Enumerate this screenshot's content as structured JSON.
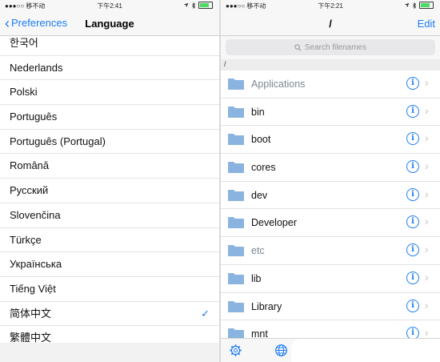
{
  "left": {
    "status": {
      "carrier": "●●●○○ 移不动",
      "time": "下午2:41"
    },
    "nav": {
      "back_label": "Preferences",
      "title": "Language"
    },
    "languages": [
      {
        "label": "한국어",
        "selected": false
      },
      {
        "label": "Nederlands",
        "selected": false
      },
      {
        "label": "Polski",
        "selected": false
      },
      {
        "label": "Português",
        "selected": false
      },
      {
        "label": "Português (Portugal)",
        "selected": false
      },
      {
        "label": "Română",
        "selected": false
      },
      {
        "label": "Русский",
        "selected": false
      },
      {
        "label": "Slovenčina",
        "selected": false
      },
      {
        "label": "Türkçe",
        "selected": false
      },
      {
        "label": "Українська",
        "selected": false
      },
      {
        "label": "Tiếng Việt",
        "selected": false
      },
      {
        "label": "简体中文",
        "selected": true
      },
      {
        "label": "繁體中文",
        "selected": false
      }
    ],
    "check_glyph": "✓"
  },
  "right": {
    "status": {
      "carrier": "●●●○○ 移不动",
      "time": "下午2:21"
    },
    "nav": {
      "title": "/",
      "edit_label": "Edit"
    },
    "search": {
      "placeholder": "Search filenames"
    },
    "path": "/",
    "files": [
      {
        "name": "Applications",
        "style": "dim"
      },
      {
        "name": "bin",
        "style": "normal"
      },
      {
        "name": "boot",
        "style": "normal"
      },
      {
        "name": "cores",
        "style": "normal"
      },
      {
        "name": "dev",
        "style": "normal"
      },
      {
        "name": "Developer",
        "style": "normal"
      },
      {
        "name": "etc",
        "style": "dim"
      },
      {
        "name": "lib",
        "style": "normal"
      },
      {
        "name": "Library",
        "style": "normal"
      },
      {
        "name": "mnt",
        "style": "normal"
      }
    ],
    "info_glyph": "i",
    "chevron_glyph": "›",
    "tabs": [
      {
        "icon": "gear-icon"
      },
      {
        "icon": "globe-icon"
      }
    ]
  },
  "colors": {
    "accent": "#1a7cf5",
    "folder": "#8ab4df",
    "text": "#111111",
    "dim_text": "#7d8792"
  }
}
